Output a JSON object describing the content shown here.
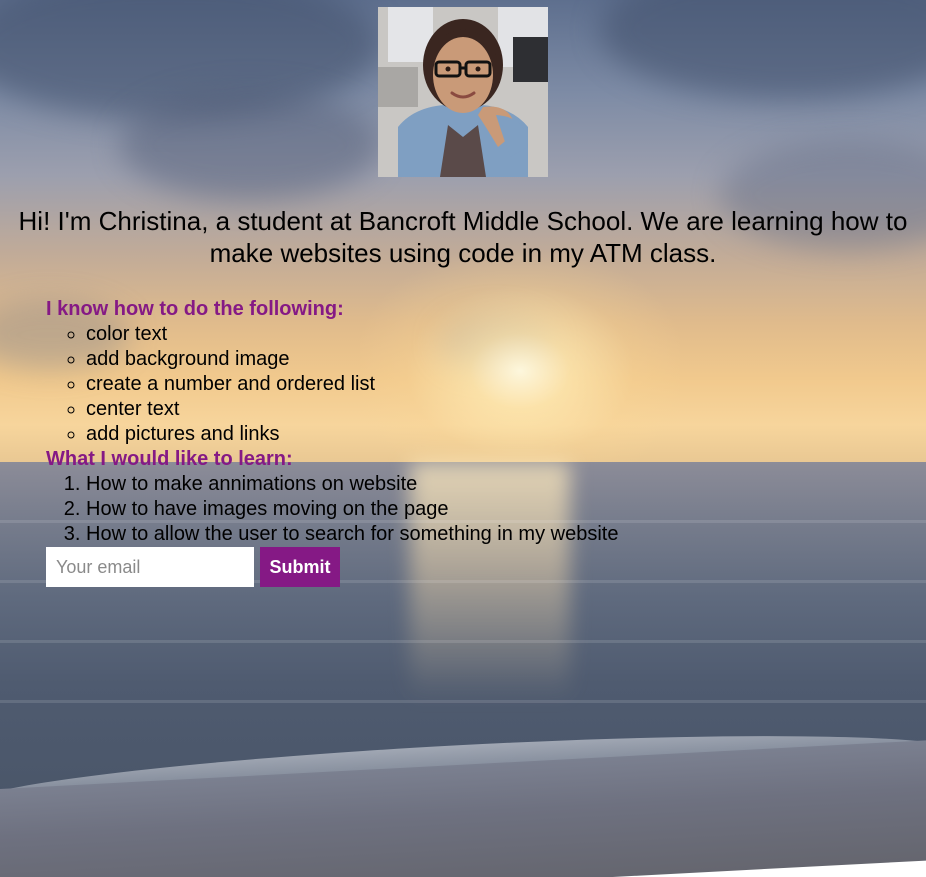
{
  "profile": {
    "photo_icon": "portrait-photo"
  },
  "intro": {
    "text": "Hi! I'm Christina, a student at Bancroft Middle School. We are learning how to make websites using code in my ATM class."
  },
  "know_section": {
    "heading": "I know how to do the following:",
    "items": [
      "color text",
      "add background image",
      "create a number and ordered list",
      "center text",
      "add pictures and links"
    ]
  },
  "learn_section": {
    "heading": "What I would like to learn:",
    "items": [
      "How to make annimations on website",
      "How to have images moving on the page",
      "How to allow the user to search for something in my website"
    ]
  },
  "signup": {
    "email_placeholder": "Your email",
    "email_value": "",
    "submit_label": "Submit"
  },
  "colors": {
    "heading": "#851985",
    "button_bg": "#851985",
    "button_text": "#ffffff"
  },
  "background": {
    "scene": "sunset-over-sea"
  }
}
